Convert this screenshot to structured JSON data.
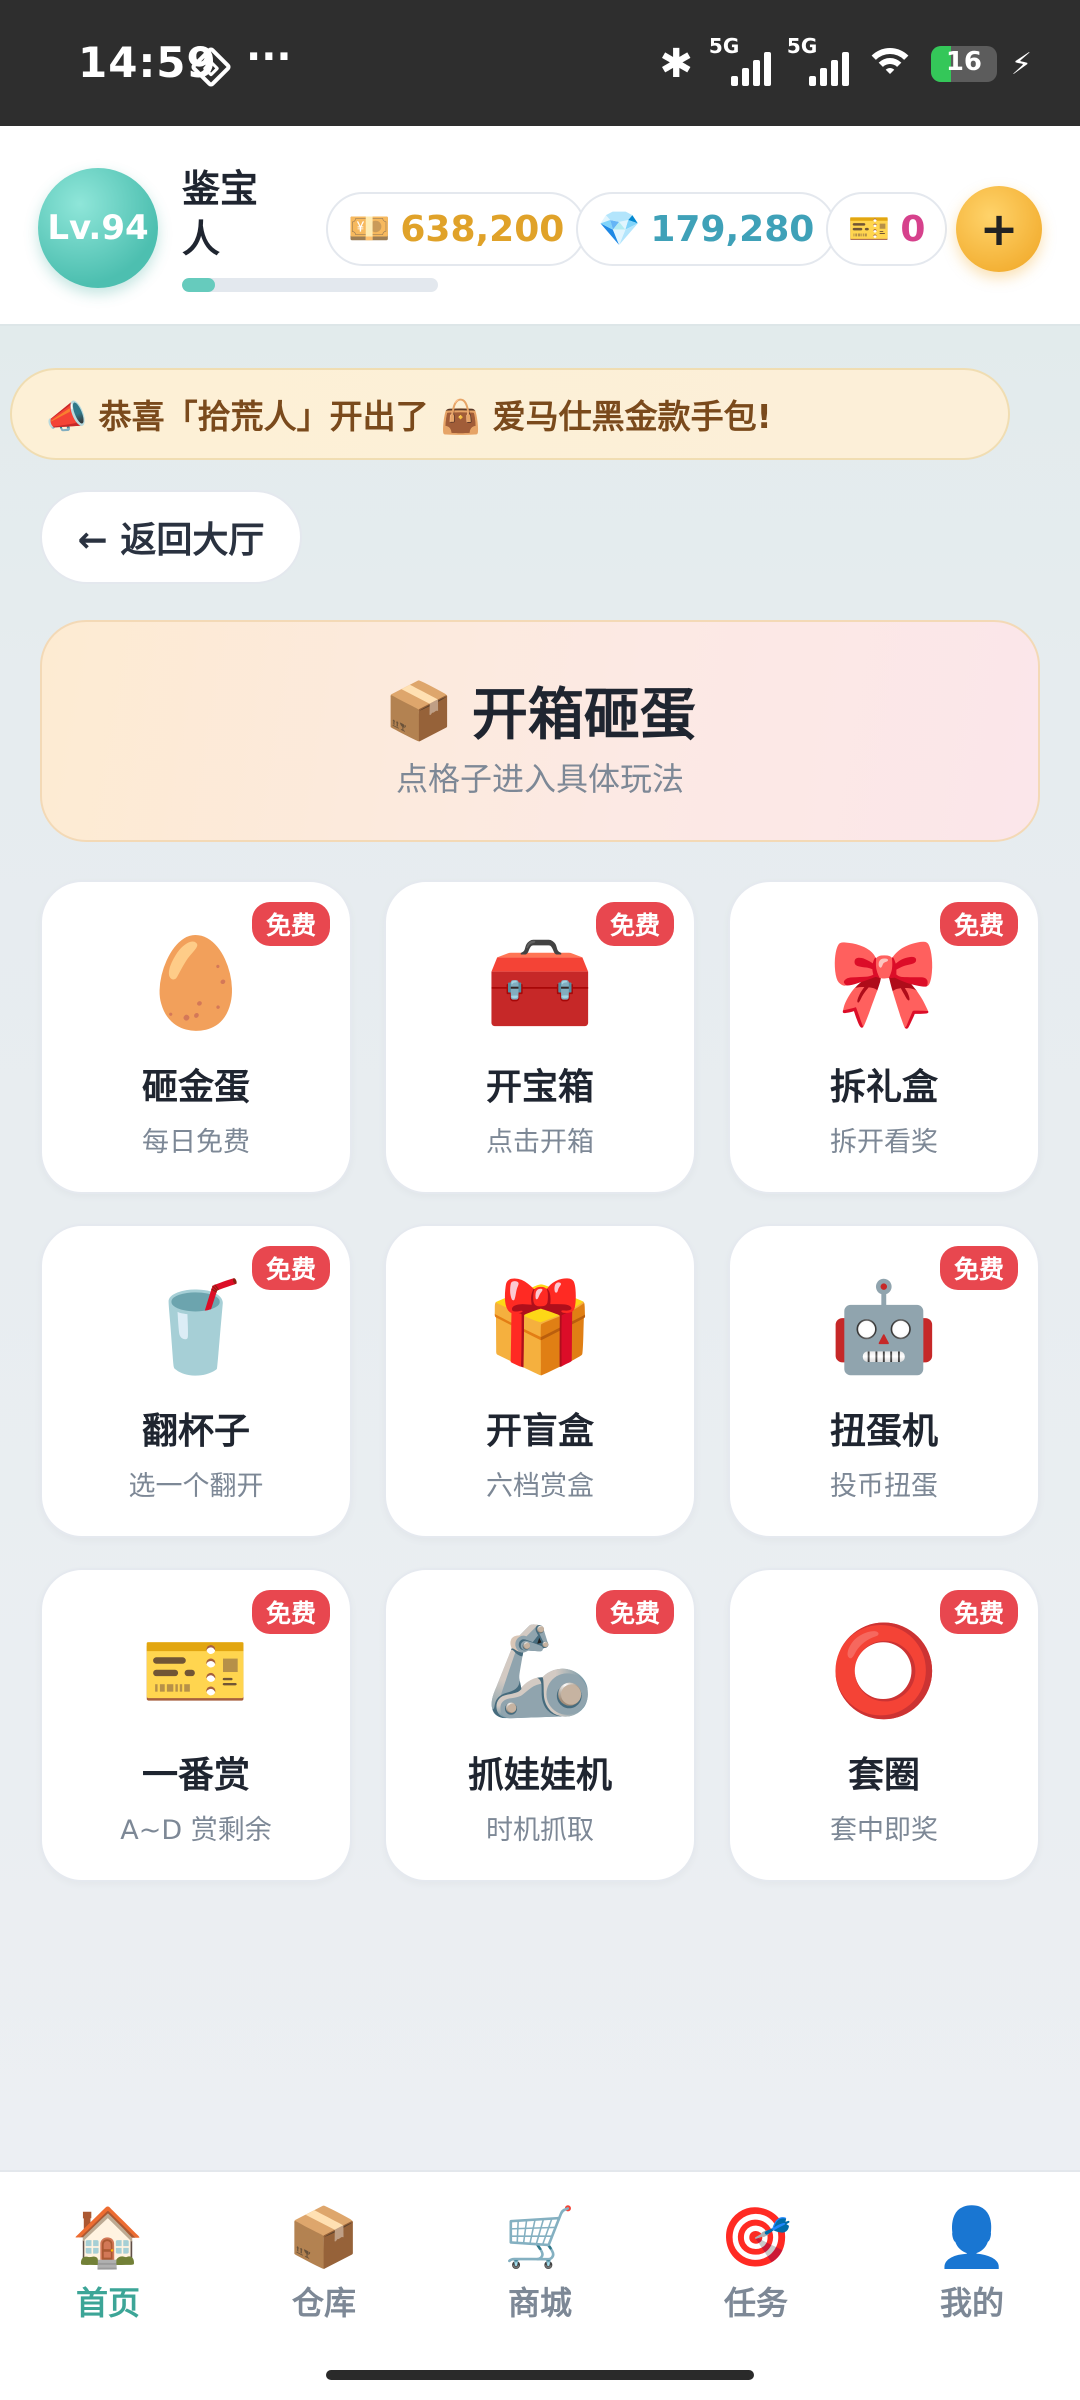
{
  "status_bar": {
    "time": "14:59",
    "dots": "···",
    "network_1": "5G",
    "network_2": "5G",
    "battery": "16"
  },
  "header": {
    "level": "Lv.94",
    "username": "鉴宝人",
    "xp_progress_fraction": 0.13,
    "gold": "638,200",
    "gems": "179,280",
    "tickets": "0",
    "plus_label": "+"
  },
  "announcement": {
    "text": "📣 恭喜「拾荒人」开出了 👜 爱马仕黑金款手包!"
  },
  "back_button": {
    "label": "← 返回大厅"
  },
  "banner": {
    "icon": "📦",
    "title": "开箱砸蛋",
    "subtitle": "点格子进入具体玩法"
  },
  "games": [
    {
      "emoji": "🥚",
      "title": "砸金蛋",
      "subtitle": "每日免费",
      "badge": "免费"
    },
    {
      "emoji": "🧰",
      "title": "开宝箱",
      "subtitle": "点击开箱",
      "badge": "免费"
    },
    {
      "emoji": "🎀",
      "title": "拆礼盒",
      "subtitle": "拆开看奖",
      "badge": "免费"
    },
    {
      "emoji": "🥤",
      "title": "翻杯子",
      "subtitle": "选一个翻开",
      "badge": "免费"
    },
    {
      "emoji": "🎁",
      "title": "开盲盒",
      "subtitle": "六档赏盒",
      "badge": ""
    },
    {
      "emoji": "🤖",
      "title": "扭蛋机",
      "subtitle": "投币扭蛋",
      "badge": "免费"
    },
    {
      "emoji": "🎫",
      "title": "一番赏",
      "subtitle": "A~D 赏剩余",
      "badge": "免费"
    },
    {
      "emoji": "🦾",
      "title": "抓娃娃机",
      "subtitle": "时机抓取",
      "badge": "免费"
    },
    {
      "emoji": "⭕",
      "title": "套圈",
      "subtitle": "套中即奖",
      "badge": "免费"
    }
  ],
  "bottom_nav": [
    {
      "icon": "🏠",
      "label": "首页",
      "active": true
    },
    {
      "icon": "📦",
      "label": "仓库",
      "active": false
    },
    {
      "icon": "🛒",
      "label": "商城",
      "active": false
    },
    {
      "icon": "🎯",
      "label": "任务",
      "active": false
    },
    {
      "icon": "👤",
      "label": "我的",
      "active": false
    }
  ],
  "colors": {
    "accent": "#3ca597",
    "gold": "#e0a229",
    "gem": "#3fa1b8",
    "ticket": "#d6418c",
    "badge": "#e8474f"
  }
}
